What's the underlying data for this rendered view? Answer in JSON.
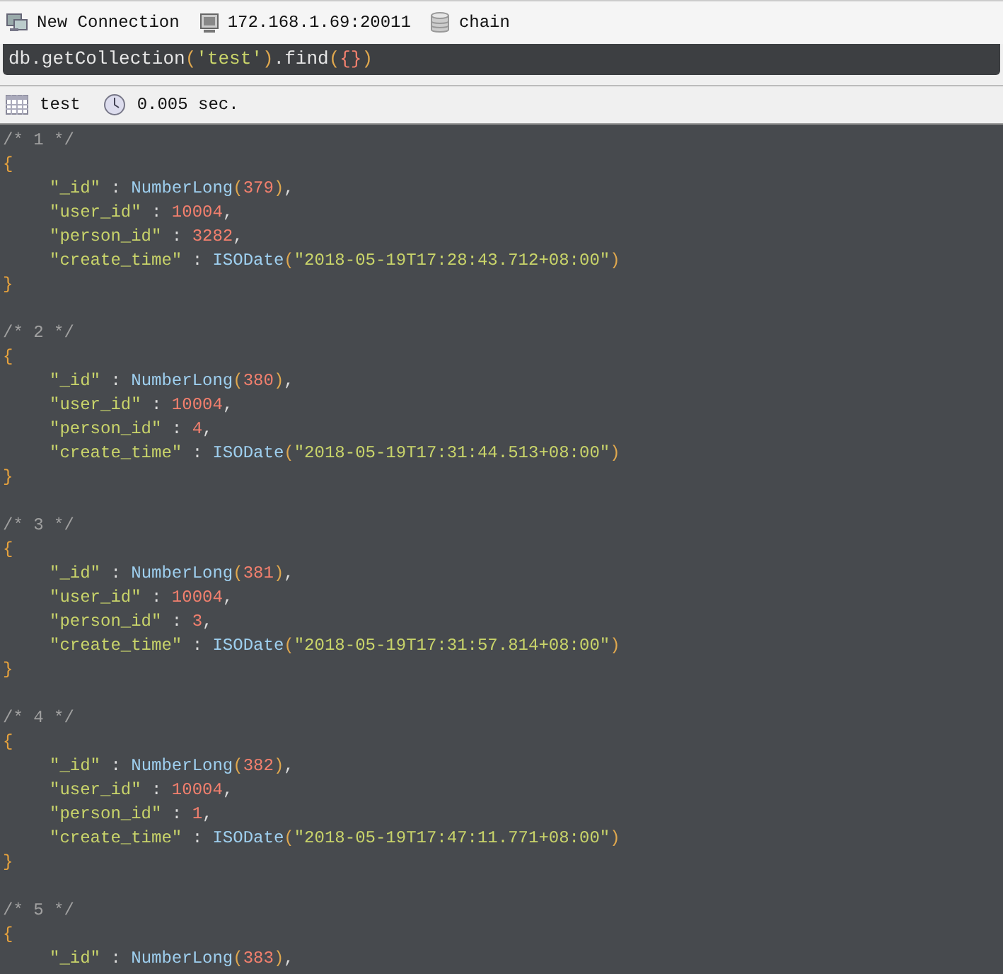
{
  "toolbar": {
    "connection": "New Connection",
    "server": "172.168.1.69:20011",
    "database": "chain"
  },
  "query": [
    {
      "kind": "ident",
      "text": "db"
    },
    {
      "kind": "punct",
      "text": "."
    },
    {
      "kind": "ident",
      "text": "getCollection"
    },
    {
      "kind": "paren",
      "text": "("
    },
    {
      "kind": "string",
      "text": "'test'"
    },
    {
      "kind": "paren",
      "text": ")"
    },
    {
      "kind": "punct",
      "text": "."
    },
    {
      "kind": "ident",
      "text": "find"
    },
    {
      "kind": "paren",
      "text": "("
    },
    {
      "kind": "number",
      "text": "{}"
    },
    {
      "kind": "paren",
      "text": ")"
    }
  ],
  "result_bar": {
    "collection": "test",
    "time": "0.005 sec."
  },
  "documents": [
    {
      "comment": "/* 1 */",
      "open": "{",
      "close": "}",
      "fields": [
        [
          {
            "kind": "key",
            "text": "\"_id\""
          },
          {
            "kind": "punct",
            "text": " : "
          },
          {
            "kind": "func",
            "text": "NumberLong"
          },
          {
            "kind": "paren",
            "text": "("
          },
          {
            "kind": "number",
            "text": "379"
          },
          {
            "kind": "paren",
            "text": ")"
          },
          {
            "kind": "punct",
            "text": ","
          }
        ],
        [
          {
            "kind": "key",
            "text": "\"user_id\""
          },
          {
            "kind": "punct",
            "text": " : "
          },
          {
            "kind": "number",
            "text": "10004"
          },
          {
            "kind": "punct",
            "text": ","
          }
        ],
        [
          {
            "kind": "key",
            "text": "\"person_id\""
          },
          {
            "kind": "punct",
            "text": " : "
          },
          {
            "kind": "number",
            "text": "3282"
          },
          {
            "kind": "punct",
            "text": ","
          }
        ],
        [
          {
            "kind": "key",
            "text": "\"create_time\""
          },
          {
            "kind": "punct",
            "text": " : "
          },
          {
            "kind": "func",
            "text": "ISODate"
          },
          {
            "kind": "paren",
            "text": "("
          },
          {
            "kind": "string",
            "text": "\"2018-05-19T17:28:43.712+08:00\""
          },
          {
            "kind": "paren",
            "text": ")"
          }
        ]
      ]
    },
    {
      "comment": "/* 2 */",
      "open": "{",
      "close": "}",
      "fields": [
        [
          {
            "kind": "key",
            "text": "\"_id\""
          },
          {
            "kind": "punct",
            "text": " : "
          },
          {
            "kind": "func",
            "text": "NumberLong"
          },
          {
            "kind": "paren",
            "text": "("
          },
          {
            "kind": "number",
            "text": "380"
          },
          {
            "kind": "paren",
            "text": ")"
          },
          {
            "kind": "punct",
            "text": ","
          }
        ],
        [
          {
            "kind": "key",
            "text": "\"user_id\""
          },
          {
            "kind": "punct",
            "text": " : "
          },
          {
            "kind": "number",
            "text": "10004"
          },
          {
            "kind": "punct",
            "text": ","
          }
        ],
        [
          {
            "kind": "key",
            "text": "\"person_id\""
          },
          {
            "kind": "punct",
            "text": " : "
          },
          {
            "kind": "number",
            "text": "4"
          },
          {
            "kind": "punct",
            "text": ","
          }
        ],
        [
          {
            "kind": "key",
            "text": "\"create_time\""
          },
          {
            "kind": "punct",
            "text": " : "
          },
          {
            "kind": "func",
            "text": "ISODate"
          },
          {
            "kind": "paren",
            "text": "("
          },
          {
            "kind": "string",
            "text": "\"2018-05-19T17:31:44.513+08:00\""
          },
          {
            "kind": "paren",
            "text": ")"
          }
        ]
      ]
    },
    {
      "comment": "/* 3 */",
      "open": "{",
      "close": "}",
      "fields": [
        [
          {
            "kind": "key",
            "text": "\"_id\""
          },
          {
            "kind": "punct",
            "text": " : "
          },
          {
            "kind": "func",
            "text": "NumberLong"
          },
          {
            "kind": "paren",
            "text": "("
          },
          {
            "kind": "number",
            "text": "381"
          },
          {
            "kind": "paren",
            "text": ")"
          },
          {
            "kind": "punct",
            "text": ","
          }
        ],
        [
          {
            "kind": "key",
            "text": "\"user_id\""
          },
          {
            "kind": "punct",
            "text": " : "
          },
          {
            "kind": "number",
            "text": "10004"
          },
          {
            "kind": "punct",
            "text": ","
          }
        ],
        [
          {
            "kind": "key",
            "text": "\"person_id\""
          },
          {
            "kind": "punct",
            "text": " : "
          },
          {
            "kind": "number",
            "text": "3"
          },
          {
            "kind": "punct",
            "text": ","
          }
        ],
        [
          {
            "kind": "key",
            "text": "\"create_time\""
          },
          {
            "kind": "punct",
            "text": " : "
          },
          {
            "kind": "func",
            "text": "ISODate"
          },
          {
            "kind": "paren",
            "text": "("
          },
          {
            "kind": "string",
            "text": "\"2018-05-19T17:31:57.814+08:00\""
          },
          {
            "kind": "paren",
            "text": ")"
          }
        ]
      ]
    },
    {
      "comment": "/* 4 */",
      "open": "{",
      "close": "}",
      "fields": [
        [
          {
            "kind": "key",
            "text": "\"_id\""
          },
          {
            "kind": "punct",
            "text": " : "
          },
          {
            "kind": "func",
            "text": "NumberLong"
          },
          {
            "kind": "paren",
            "text": "("
          },
          {
            "kind": "number",
            "text": "382"
          },
          {
            "kind": "paren",
            "text": ")"
          },
          {
            "kind": "punct",
            "text": ","
          }
        ],
        [
          {
            "kind": "key",
            "text": "\"user_id\""
          },
          {
            "kind": "punct",
            "text": " : "
          },
          {
            "kind": "number",
            "text": "10004"
          },
          {
            "kind": "punct",
            "text": ","
          }
        ],
        [
          {
            "kind": "key",
            "text": "\"person_id\""
          },
          {
            "kind": "punct",
            "text": " : "
          },
          {
            "kind": "number",
            "text": "1"
          },
          {
            "kind": "punct",
            "text": ","
          }
        ],
        [
          {
            "kind": "key",
            "text": "\"create_time\""
          },
          {
            "kind": "punct",
            "text": " : "
          },
          {
            "kind": "func",
            "text": "ISODate"
          },
          {
            "kind": "paren",
            "text": "("
          },
          {
            "kind": "string",
            "text": "\"2018-05-19T17:47:11.771+08:00\""
          },
          {
            "kind": "paren",
            "text": ")"
          }
        ]
      ]
    },
    {
      "comment": "/* 5 */",
      "open": "{",
      "fields": [
        [
          {
            "kind": "key",
            "text": "\"_id\""
          },
          {
            "kind": "punct",
            "text": " : "
          },
          {
            "kind": "func",
            "text": "NumberLong"
          },
          {
            "kind": "paren",
            "text": "("
          },
          {
            "kind": "number",
            "text": "383"
          },
          {
            "kind": "paren",
            "text": ")"
          },
          {
            "kind": "punct",
            "text": ","
          }
        ]
      ]
    }
  ]
}
